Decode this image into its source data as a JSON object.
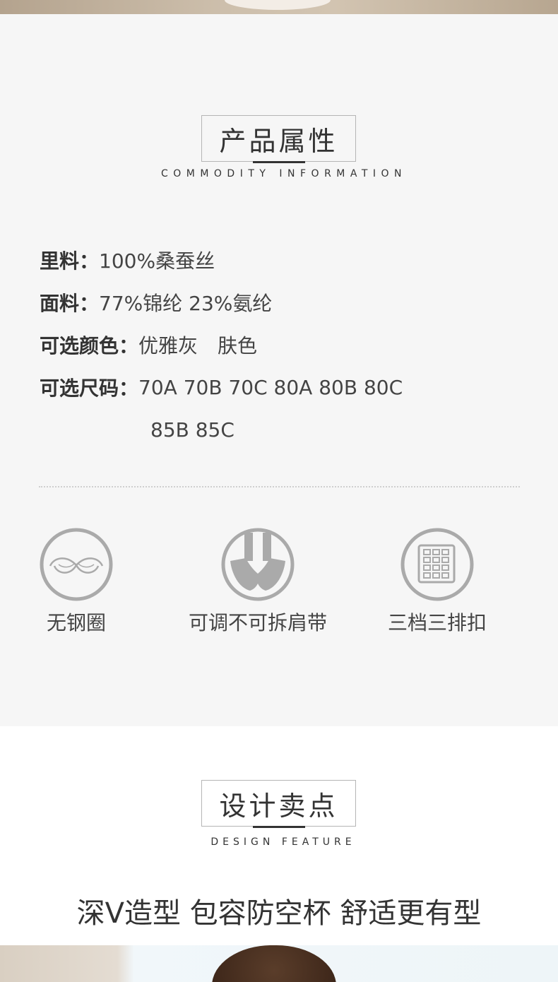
{
  "attributes_section": {
    "title": "产品属性",
    "subtitle": "COMMODITY INFORMATION",
    "rows": [
      {
        "label": "里料：",
        "value": "100%桑蚕丝"
      },
      {
        "label": "面料：",
        "value": "77%锦纶 23%氨纶"
      },
      {
        "label": "可选颜色：",
        "value": "优雅灰　肤色"
      },
      {
        "label": "可选尺码：",
        "value": "70A 70B 70C 80A 80B 80C"
      },
      {
        "label": "",
        "value": "85B 85C"
      }
    ],
    "features": [
      {
        "icon": "no-underwire-icon",
        "label": "无钢圈"
      },
      {
        "icon": "fixed-strap-icon",
        "label": "可调不可拆肩带"
      },
      {
        "icon": "hook-eye-icon",
        "label": "三档三排扣"
      }
    ]
  },
  "design_section": {
    "title": "设计卖点",
    "subtitle": "DESIGN FEATURE",
    "headline": "深V造型 包容防空杯 舒适更有型"
  },
  "colors": {
    "section_bg": "#f6f6f6",
    "icon_gray": "#aaaaaa",
    "text": "#333333"
  }
}
